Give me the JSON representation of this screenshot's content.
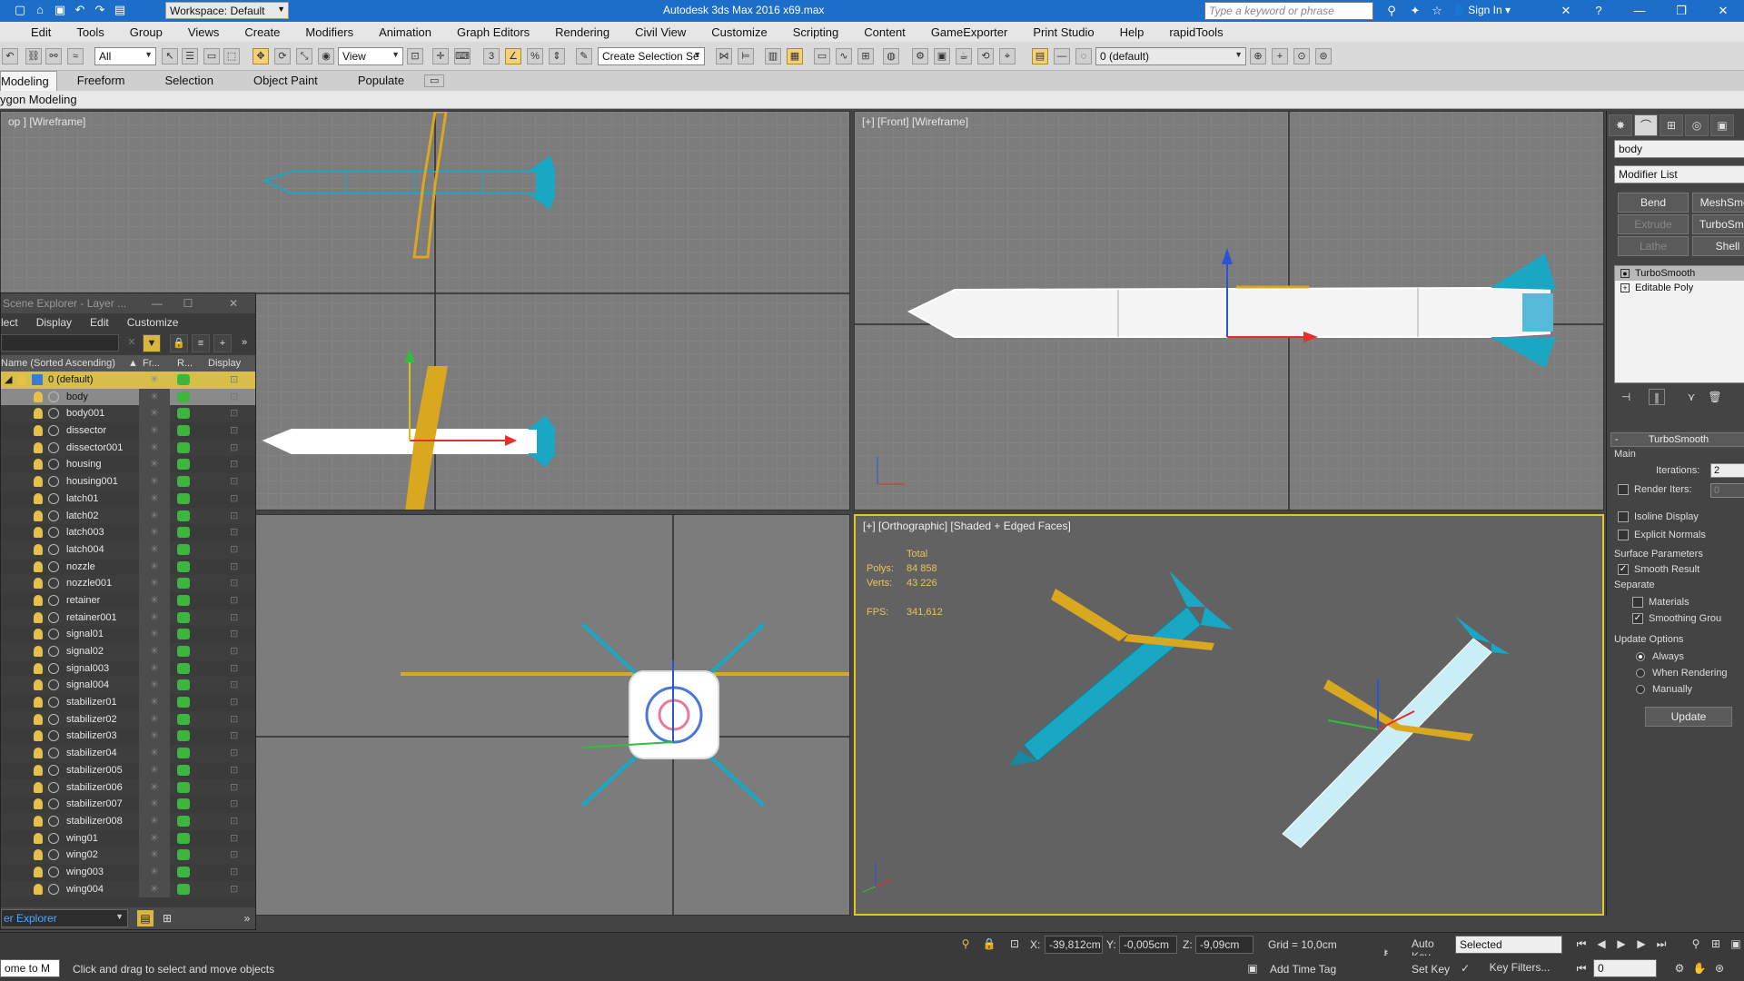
{
  "titlebar": {
    "workspace": "Workspace: Default",
    "app_title": "Autodesk 3ds Max 2016    x69.max",
    "search_placeholder": "Type a keyword or phrase",
    "sign_in": "Sign In"
  },
  "menubar": [
    "Edit",
    "Tools",
    "Group",
    "Views",
    "Create",
    "Modifiers",
    "Animation",
    "Graph Editors",
    "Rendering",
    "Civil View",
    "Customize",
    "Scripting",
    "Content",
    "GameExporter",
    "Print Studio",
    "Help",
    "rapidTools"
  ],
  "toolbar": {
    "filter_select": "All",
    "ref_coord": "View",
    "selection_set": "Create Selection Se",
    "layer_select": "0 (default)"
  },
  "ribbon": {
    "tabs": [
      "Modeling",
      "Freeform",
      "Selection",
      "Object Paint",
      "Populate"
    ],
    "active_tab": "Modeling",
    "sub_label": "ygon Modeling"
  },
  "viewports": {
    "top_label": "op ] [Wireframe]",
    "front_label": "[+] [Front] [Wireframe]",
    "persp_label": "[+] [Orthographic] [Shaded + Edged Faces]",
    "stats": {
      "total": "Total",
      "polys_label": "Polys:",
      "polys_value": "84 858",
      "verts_label": "Verts:",
      "verts_value": "43 226",
      "fps_label": "FPS:",
      "fps_value": "341,612"
    }
  },
  "scene_explorer": {
    "title": "Scene Explorer - Layer ...",
    "menu": [
      "lect",
      "Display",
      "Edit",
      "Customize"
    ],
    "columns": {
      "name": "Name (Sorted Ascending)",
      "freeze": "Fr...",
      "render": "R...",
      "display": "Display a..."
    },
    "root": "0 (default)",
    "selected": "body",
    "objects": [
      "body",
      "body001",
      "dissector",
      "dissector001",
      "housing",
      "housing001",
      "latch01",
      "latch02",
      "latch003",
      "latch004",
      "nozzle",
      "nozzle001",
      "retainer",
      "retainer001",
      "signal01",
      "signal02",
      "signal003",
      "signal004",
      "stabilizer01",
      "stabilizer02",
      "stabilizer03",
      "stabilizer04",
      "stabilizer005",
      "stabilizer006",
      "stabilizer007",
      "stabilizer008",
      "wing01",
      "wing02",
      "wing003",
      "wing004"
    ],
    "footer_dropdown": "er Explorer"
  },
  "command_panel": {
    "object_name": "body",
    "modifier_list": "Modifier List",
    "buttons": [
      {
        "label": "Bend",
        "enabled": true
      },
      {
        "label": "MeshSmoo",
        "enabled": true
      },
      {
        "label": "Extrude",
        "enabled": false
      },
      {
        "label": "TurboSmoo",
        "enabled": true
      },
      {
        "label": "Lathe",
        "enabled": false
      },
      {
        "label": "Shell",
        "enabled": true
      }
    ],
    "stack": [
      "TurboSmooth",
      "Editable Poly"
    ],
    "rollout_title": "TurboSmooth",
    "main_group": "Main",
    "iterations_label": "Iterations:",
    "iterations_value": "2",
    "render_iters_label": "Render Iters:",
    "render_iters_value": "0",
    "isoline": "Isoline Display",
    "explicit_normals": "Explicit Normals",
    "surface_params": "Surface Parameters",
    "smooth_result": "Smooth Result",
    "separate": "Separate",
    "materials": "Materials",
    "smoothing_groups": "Smoothing Grou",
    "update_options": "Update Options",
    "always": "Always",
    "when_rendering": "When Rendering",
    "manually": "Manually",
    "update_button": "Update"
  },
  "status": {
    "prompt_left": "ome to M",
    "prompt": "Click and drag to select and move objects",
    "x_label": "X:",
    "x_value": "-39,812cm",
    "y_label": "Y:",
    "y_value": "-0,005cm",
    "z_label": "Z:",
    "z_value": "-9,09cm",
    "grid": "Grid = 10,0cm",
    "auto_key": "Auto Key",
    "set_key": "Set Key",
    "selected": "Selected",
    "key_filters": "Key Filters...",
    "add_time_tag": "Add Time Tag",
    "frame": "0"
  },
  "colors": {
    "accent": "#1c6ec9",
    "selection_yellow": "#e5c61e",
    "missile_teal": "#1aa7c4",
    "wing_gold": "#d9a81e"
  }
}
